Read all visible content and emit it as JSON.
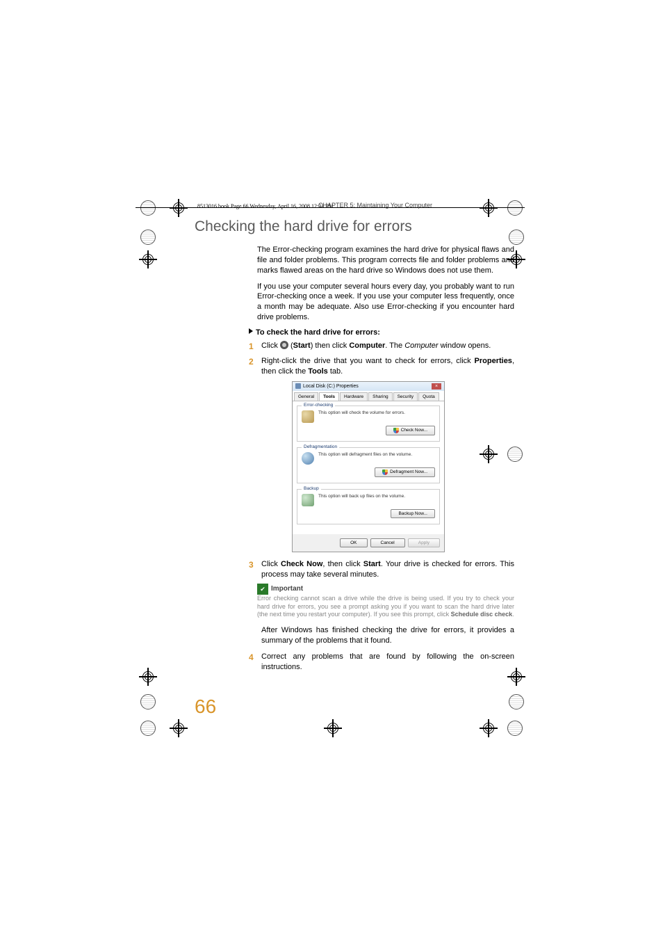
{
  "book_ref": "8513016.book  Page 66  Wednesday, April 16, 2008  12:01 PM",
  "chapter_line": "CHAPTER 5: Maintaining Your Computer",
  "section_title": "Checking the hard drive for errors",
  "para1": "The Error-checking program examines the hard drive for physical flaws and file and folder problems. This program corrects file and folder problems and marks flawed areas on the hard drive so Windows does not use them.",
  "para2": "If you use your computer several hours every day, you probably want to run Error-checking once a week. If you use your computer less frequently, once a month may be adequate. Also use Error-checking if you encounter hard drive problems.",
  "procedure_title": "To check the hard drive for errors:",
  "steps": {
    "s1_a": "Click ",
    "s1_b": " (",
    "s1_start": "Start",
    "s1_c": ") then click ",
    "s1_computer": "Computer",
    "s1_d": ". The ",
    "s1_computer_i": "Computer",
    "s1_e": " window opens.",
    "s2_a": "Right-click the drive that you want to check for errors, click ",
    "s2_props": "Properties",
    "s2_b": ", then click the ",
    "s2_tools": "Tools",
    "s2_c": " tab.",
    "s3_a": "Click ",
    "s3_cn": "Check Now",
    "s3_b": ", then click ",
    "s3_start": "Start",
    "s3_c": ". Your drive is checked for errors. This process may take several minutes.",
    "s3_after": "After Windows has finished checking the drive for errors, it provides a summary of the problems that it found.",
    "s4": "Correct any problems that are found by following the on-screen instructions."
  },
  "callout": {
    "title": "Important",
    "body_a": "Error checking cannot scan a drive while the drive is being used. If you try to check your hard drive for errors, you see a prompt asking you if you want to scan the hard drive later (the next time you restart your computer). If you see this prompt, click ",
    "body_bold": "Schedule disc check",
    "body_b": "."
  },
  "dialog": {
    "title": "Local Disk (C:) Properties",
    "tabs": [
      "General",
      "Tools",
      "Hardware",
      "Sharing",
      "Security",
      "Quota"
    ],
    "active_tab": 1,
    "groups": {
      "errorcheck": {
        "label": "Error-checking",
        "text": "This option will check the volume for errors.",
        "button": "Check Now..."
      },
      "defrag": {
        "label": "Defragmentation",
        "text": "This option will defragment files on the volume.",
        "button": "Defragment Now..."
      },
      "backup": {
        "label": "Backup",
        "text": "This option will back up files on the volume.",
        "button": "Backup Now..."
      }
    },
    "footer": {
      "ok": "OK",
      "cancel": "Cancel",
      "apply": "Apply"
    }
  },
  "page_number": "66"
}
